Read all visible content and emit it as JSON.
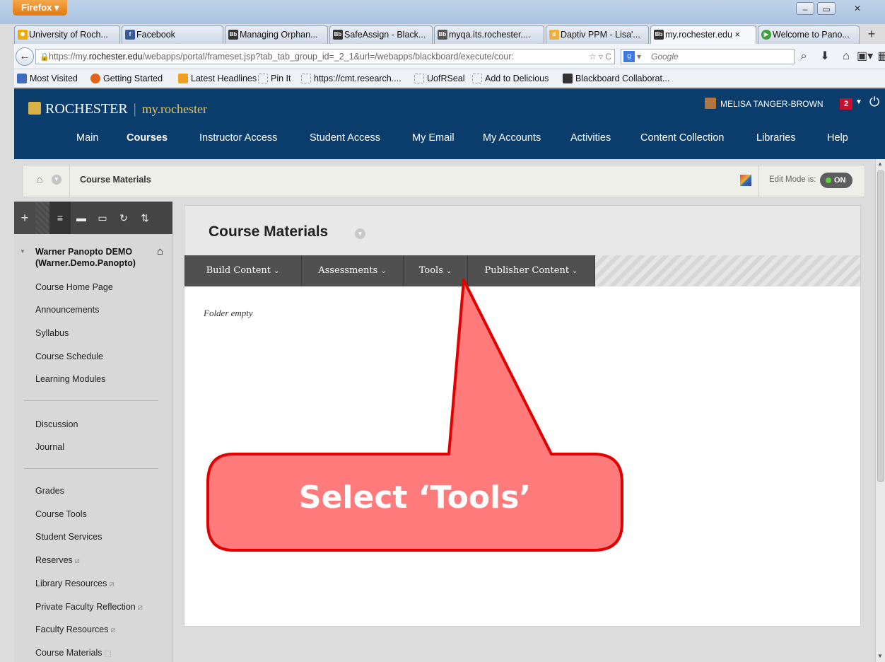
{
  "browser": {
    "app_button": "Firefox",
    "tabs": [
      {
        "label": "University of Roch...",
        "favicon_color": "#f2a900"
      },
      {
        "label": "Facebook",
        "favicon_color": "#3b5998"
      },
      {
        "label": "Managing Orphan...",
        "favicon_color": "#333333"
      },
      {
        "label": "SafeAssign - Black...",
        "favicon_color": "#333333"
      },
      {
        "label": "myqa.its.rochester....",
        "favicon_color": "#333333"
      },
      {
        "label": "Daptiv PPM - Lisa'...",
        "favicon_color": "#f0b040"
      },
      {
        "label": "my.rochester.edu",
        "favicon_color": "#333333"
      },
      {
        "label": "Welcome to Pano...",
        "favicon_color": "#3aa03a"
      }
    ],
    "active_tab_close": "×",
    "new_tab": "+",
    "url_prefix": "https://my.",
    "url_domain": "rochester.edu",
    "url_rest": "/webapps/portal/frameset.jsp?tab_tab_group_id=_2_1&url=/webapps/blackboard/execute/cour:",
    "search_placeholder": "Google",
    "bookmarks": [
      "Most Visited",
      "Getting Started",
      "Latest Headlines",
      "Pin It",
      "https://cmt.research....",
      "UofRSeal",
      "Add to Delicious",
      "Blackboard Collaborat..."
    ]
  },
  "header": {
    "logo_university": "ROCHESTER",
    "logo_portal": "my.rochester",
    "user_name": "MELISA TANGER-BROWN",
    "notification_count": "2",
    "nav": [
      "Main",
      "Courses",
      "Instructor Access",
      "Student Access",
      "My Email",
      "My Accounts",
      "Activities",
      "Content Collection",
      "Libraries",
      "Help"
    ],
    "active_nav": "Courses"
  },
  "breadcrumb": {
    "current": "Course Materials",
    "edit_mode_label": "Edit Mode is:",
    "edit_mode_value": "ON"
  },
  "sidebar": {
    "course_name": "Warner Panopto DEMO",
    "course_id": "(Warner.Demo.Panopto)",
    "group1": [
      "Course Home Page",
      "Announcements",
      "Syllabus",
      "Course Schedule",
      "Learning Modules"
    ],
    "group2": [
      "Discussion",
      "Journal"
    ],
    "group3": [
      "Grades",
      "Course Tools",
      "Student Services",
      "Reserves",
      "Library Resources",
      "Private Faculty Reflection",
      "Faculty Resources",
      "Course Materials"
    ]
  },
  "content": {
    "title": "Course Materials",
    "action_buttons": [
      "Build Content",
      "Assessments",
      "Tools",
      "Publisher Content"
    ],
    "empty_message": "Folder empty"
  },
  "callout": {
    "text": "Select ‘Tools’",
    "fill": "#ff7b7b",
    "border": "#e00000"
  }
}
